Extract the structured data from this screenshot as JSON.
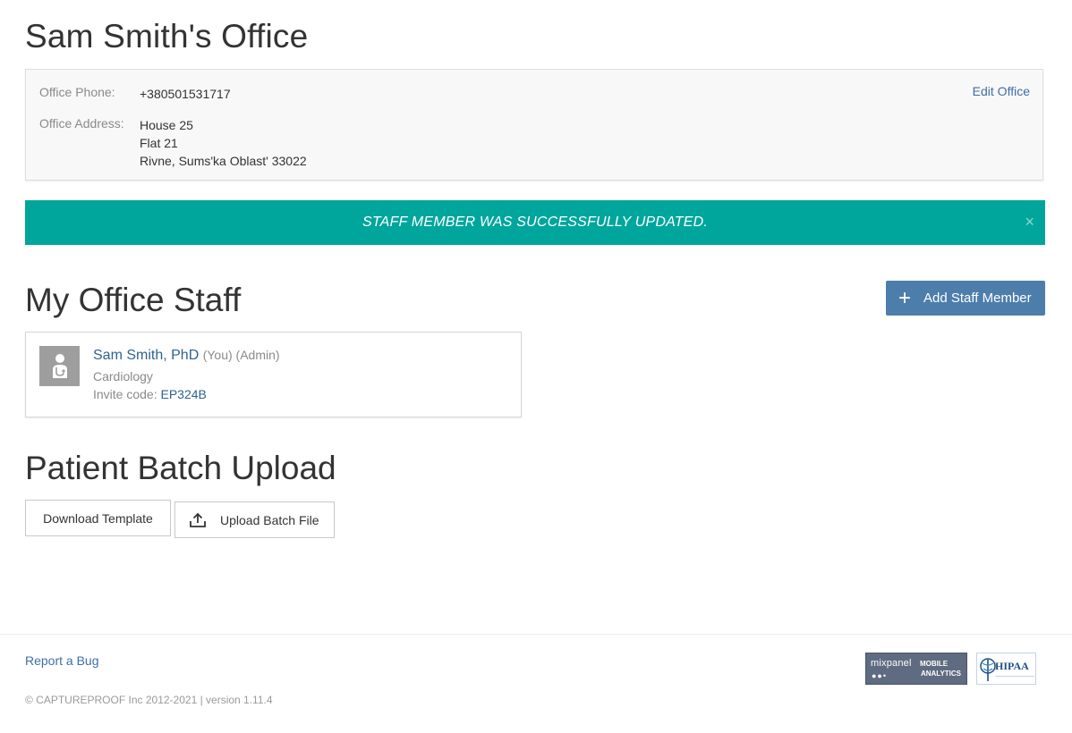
{
  "office": {
    "title": "Sam Smith's Office",
    "phone_label": "Office Phone:",
    "phone": "+380501531717",
    "address_label": "Office Address:",
    "address_lines": [
      "House 25",
      "Flat 21",
      "Rivne, Sums'ka Oblast' 33022"
    ],
    "edit_label": "Edit Office"
  },
  "alert": {
    "message": "STAFF MEMBER WAS SUCCESSFULLY UPDATED.",
    "close_glyph": "×",
    "background": "#00a69c"
  },
  "staff_section": {
    "title": "My Office Staff",
    "add_button_label": "Add Staff Member",
    "add_button_icon": "plus-icon",
    "members": [
      {
        "name": "Sam Smith, PhD",
        "tags": "(You) (Admin)",
        "specialty": "Cardiology",
        "invite_label": "Invite code:",
        "invite_code": "EP324B",
        "avatar_icon": "doctor-avatar-icon"
      }
    ]
  },
  "batch_section": {
    "title": "Patient Batch Upload",
    "download_label": "Download Template",
    "upload_label": "Upload Batch File",
    "upload_icon": "upload-icon"
  },
  "footer": {
    "report_bug": "Report a Bug",
    "copyright": "© CAPTUREPROOF Inc 2012-2021 | version 1.11.4",
    "mixpanel_word": "mixpanel",
    "mixpanel_mobile": "MOBILE",
    "mixpanel_analytics": "ANALYTICS",
    "hipaa_word": "HIPAA"
  },
  "colors": {
    "accent_blue": "#4d7eab",
    "link_blue": "#3e6fa6",
    "success_teal": "#00a69c"
  }
}
